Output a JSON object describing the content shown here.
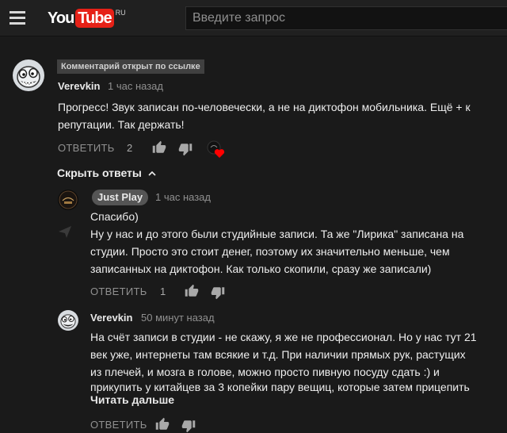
{
  "header": {
    "logo_you": "You",
    "logo_tube": "Tube",
    "logo_region": "RU",
    "search_placeholder": "Введите запрос"
  },
  "comment": {
    "linked_badge": "Комментарий открыт по ссылке",
    "author": "Verevkin",
    "time": "1 час назад",
    "text_line1": "Прогресс! Звук записан по-человечески, а не на диктофон мобильника. Ещё + к",
    "text_line2": "репутации. Так держать!",
    "reply_label": "ОТВЕТИТЬ",
    "likes": "2",
    "hide_replies_label": "Скрыть ответы"
  },
  "replies": [
    {
      "author": "Just Play",
      "time": "1 час назад",
      "lines": [
        "Спасибо)",
        "Ну у нас и до этого были студийные записи. Та же \"Лирика\" записана на",
        "студии. Просто это стоит денег, поэтому их значительно меньше, чем",
        "записанных на диктофон. Как только скопили, сразу же записали)"
      ],
      "reply_label": "ОТВЕТИТЬ",
      "likes": "1"
    },
    {
      "author": "Verevkin",
      "time": "50 минут назад",
      "lines": [
        "На счёт записи в студии - не скажу, я же не профессионал. Но у нас тут 21",
        "век уже, интернеты там всякие и т.д. При наличии прямых рук, растущих",
        "из плечей, и мозга в голове, можно просто пивную посуду сдать :) и",
        "прикупить у китайцев за 3 копейки пару вещиц, которые затем прицепить"
      ],
      "read_more": "Читать дальше",
      "reply_label": "ОТВЕТИТЬ"
    }
  ],
  "colors": {
    "background": "#1a1a1a",
    "header": "#202020",
    "brand_red": "#e62117",
    "heart": "#ff0000",
    "muted_text": "#909090"
  },
  "icons": [
    "menu-icon",
    "thumb-up-icon",
    "thumb-down-icon",
    "heart-icon",
    "chevron-up-icon",
    "flag-icon"
  ]
}
